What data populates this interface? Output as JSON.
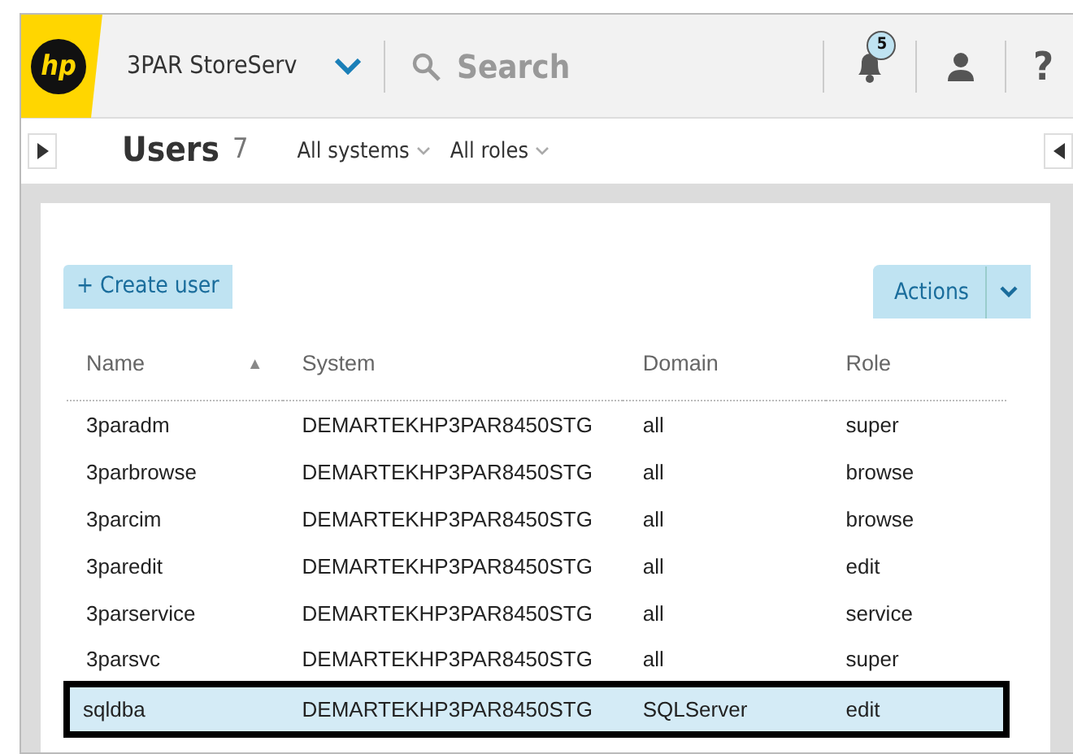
{
  "header": {
    "logo": "hp",
    "product": "3PAR StoreServ",
    "search": {
      "placeholder": "Search"
    },
    "notifications": "5",
    "help": "?"
  },
  "subheader": {
    "title": "Users",
    "count": "7",
    "filters": [
      "All systems",
      "All roles"
    ]
  },
  "toolbar": {
    "create": "+ Create user",
    "actions": "Actions"
  },
  "table": {
    "columns": [
      {
        "label": "Name",
        "sorted": true
      },
      {
        "label": "System",
        "sorted": false
      },
      {
        "label": "Domain",
        "sorted": false
      },
      {
        "label": "Role",
        "sorted": false
      }
    ],
    "sort_glyph": "▲",
    "rows": [
      {
        "cells": [
          "3paradm",
          "DEMARTEKHP3PAR8450STG",
          "all",
          "super"
        ],
        "selected": false
      },
      {
        "cells": [
          "3parbrowse",
          "DEMARTEKHP3PAR8450STG",
          "all",
          "browse"
        ],
        "selected": false
      },
      {
        "cells": [
          "3parcim",
          "DEMARTEKHP3PAR8450STG",
          "all",
          "browse"
        ],
        "selected": false
      },
      {
        "cells": [
          "3paredit",
          "DEMARTEKHP3PAR8450STG",
          "all",
          "edit"
        ],
        "selected": false
      },
      {
        "cells": [
          "3parservice",
          "DEMARTEKHP3PAR8450STG",
          "all",
          "service"
        ],
        "selected": false
      },
      {
        "cells": [
          "3parsvc",
          "DEMARTEKHP3PAR8450STG",
          "all",
          "super"
        ],
        "selected": false
      },
      {
        "cells": [
          "sqldba",
          "DEMARTEKHP3PAR8450STG",
          "SQLServer",
          "edit"
        ],
        "selected": true
      }
    ]
  }
}
